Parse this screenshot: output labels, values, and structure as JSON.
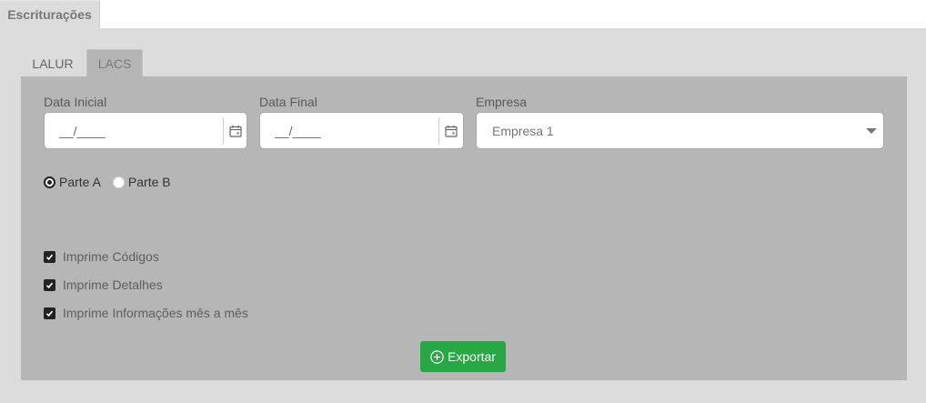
{
  "main_tab": {
    "label": "Escriturações"
  },
  "sub_tabs": [
    {
      "label": "LALUR",
      "active": false
    },
    {
      "label": "LACS",
      "active": true
    }
  ],
  "form": {
    "data_inicial": {
      "label": "Data Inicial",
      "value": "__/____"
    },
    "data_final": {
      "label": "Data Final",
      "value": "__/____"
    },
    "empresa": {
      "label": "Empresa",
      "selected": "Empresa 1"
    },
    "parte": {
      "options": [
        {
          "label": "Parte A",
          "checked": true
        },
        {
          "label": "Parte B",
          "checked": false
        }
      ]
    },
    "checkboxes": [
      {
        "label": "Imprime Códigos",
        "checked": true
      },
      {
        "label": "Imprime Detalhes",
        "checked": true
      },
      {
        "label": "Imprime Informações mês a mês",
        "checked": true
      }
    ],
    "export_button": {
      "label": "Exportar",
      "icon": "plus-circle-icon"
    }
  },
  "colors": {
    "accent": "#28a745",
    "panel": "#b6b6b6",
    "background": "#dcdcdc"
  }
}
